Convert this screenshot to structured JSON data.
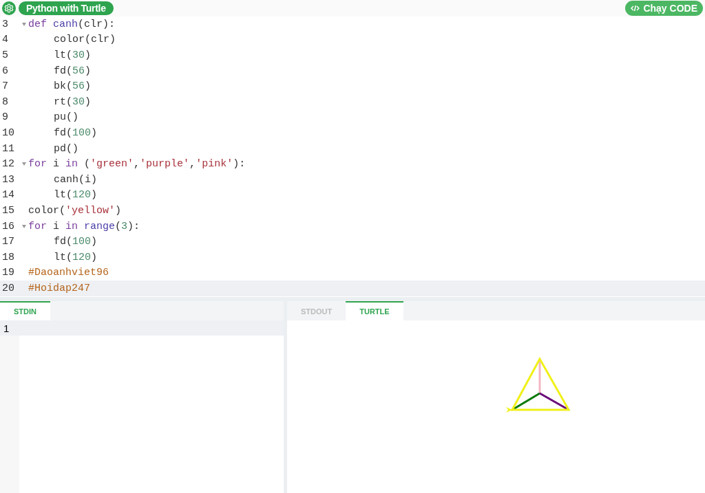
{
  "header": {
    "title": "Python with Turtle",
    "run_button": "Chạy CODE"
  },
  "editor": {
    "lines": [
      {
        "number": "3",
        "fold": true,
        "current": false,
        "indent": false,
        "tokens": [
          {
            "kind": "kw",
            "text": "def "
          },
          {
            "kind": "def",
            "text": "canh"
          },
          {
            "kind": "plain",
            "text": "(clr):"
          }
        ]
      },
      {
        "number": "4",
        "fold": false,
        "current": false,
        "indent": true,
        "tokens": [
          {
            "kind": "plain",
            "text": "color(clr)"
          }
        ]
      },
      {
        "number": "5",
        "fold": false,
        "current": false,
        "indent": true,
        "tokens": [
          {
            "kind": "plain",
            "text": "lt("
          },
          {
            "kind": "num",
            "text": "30"
          },
          {
            "kind": "plain",
            "text": ")"
          }
        ]
      },
      {
        "number": "6",
        "fold": false,
        "current": false,
        "indent": true,
        "tokens": [
          {
            "kind": "plain",
            "text": "fd("
          },
          {
            "kind": "num",
            "text": "56"
          },
          {
            "kind": "plain",
            "text": ")"
          }
        ]
      },
      {
        "number": "7",
        "fold": false,
        "current": false,
        "indent": true,
        "tokens": [
          {
            "kind": "plain",
            "text": "bk("
          },
          {
            "kind": "num",
            "text": "56"
          },
          {
            "kind": "plain",
            "text": ")"
          }
        ]
      },
      {
        "number": "8",
        "fold": false,
        "current": false,
        "indent": true,
        "tokens": [
          {
            "kind": "plain",
            "text": "rt("
          },
          {
            "kind": "num",
            "text": "30"
          },
          {
            "kind": "plain",
            "text": ")"
          }
        ]
      },
      {
        "number": "9",
        "fold": false,
        "current": false,
        "indent": true,
        "tokens": [
          {
            "kind": "plain",
            "text": "pu()"
          }
        ]
      },
      {
        "number": "10",
        "fold": false,
        "current": false,
        "indent": true,
        "tokens": [
          {
            "kind": "plain",
            "text": "fd("
          },
          {
            "kind": "num",
            "text": "100"
          },
          {
            "kind": "plain",
            "text": ")"
          }
        ]
      },
      {
        "number": "11",
        "fold": false,
        "current": false,
        "indent": true,
        "tokens": [
          {
            "kind": "plain",
            "text": "pd()"
          }
        ]
      },
      {
        "number": "12",
        "fold": true,
        "current": false,
        "indent": false,
        "tokens": [
          {
            "kind": "kw",
            "text": "for"
          },
          {
            "kind": "plain",
            "text": " i "
          },
          {
            "kind": "kw",
            "text": "in"
          },
          {
            "kind": "plain",
            "text": " ("
          },
          {
            "kind": "str",
            "text": "'green'"
          },
          {
            "kind": "plain",
            "text": ","
          },
          {
            "kind": "str",
            "text": "'purple'"
          },
          {
            "kind": "plain",
            "text": ","
          },
          {
            "kind": "str",
            "text": "'pink'"
          },
          {
            "kind": "plain",
            "text": "):"
          }
        ]
      },
      {
        "number": "13",
        "fold": false,
        "current": false,
        "indent": true,
        "tokens": [
          {
            "kind": "plain",
            "text": "canh(i)"
          }
        ]
      },
      {
        "number": "14",
        "fold": false,
        "current": false,
        "indent": true,
        "tokens": [
          {
            "kind": "plain",
            "text": "lt("
          },
          {
            "kind": "num",
            "text": "120"
          },
          {
            "kind": "plain",
            "text": ")"
          }
        ]
      },
      {
        "number": "15",
        "fold": false,
        "current": false,
        "indent": false,
        "tokens": [
          {
            "kind": "plain",
            "text": "color("
          },
          {
            "kind": "str",
            "text": "'yellow'"
          },
          {
            "kind": "plain",
            "text": ")"
          }
        ]
      },
      {
        "number": "16",
        "fold": true,
        "current": false,
        "indent": false,
        "tokens": [
          {
            "kind": "kw",
            "text": "for"
          },
          {
            "kind": "plain",
            "text": " i "
          },
          {
            "kind": "kw",
            "text": "in "
          },
          {
            "kind": "def",
            "text": "range"
          },
          {
            "kind": "plain",
            "text": "("
          },
          {
            "kind": "num",
            "text": "3"
          },
          {
            "kind": "plain",
            "text": "):"
          }
        ]
      },
      {
        "number": "17",
        "fold": false,
        "current": false,
        "indent": true,
        "tokens": [
          {
            "kind": "plain",
            "text": "fd("
          },
          {
            "kind": "num",
            "text": "100"
          },
          {
            "kind": "plain",
            "text": ")"
          }
        ]
      },
      {
        "number": "18",
        "fold": false,
        "current": false,
        "indent": true,
        "tokens": [
          {
            "kind": "plain",
            "text": "lt("
          },
          {
            "kind": "num",
            "text": "120"
          },
          {
            "kind": "plain",
            "text": ")"
          }
        ]
      },
      {
        "number": "19",
        "fold": false,
        "current": false,
        "indent": false,
        "tokens": [
          {
            "kind": "comment",
            "text": "#Daoanhviet96"
          }
        ]
      },
      {
        "number": "20",
        "fold": false,
        "current": true,
        "indent": false,
        "tokens": [
          {
            "kind": "comment",
            "text": "#Hoidap247"
          }
        ]
      }
    ]
  },
  "input_panel": {
    "tabs": [
      {
        "label": "STDIN",
        "selected": true
      }
    ],
    "lines": [
      {
        "number": "1",
        "current": true
      }
    ]
  },
  "output_panel": {
    "tabs": [
      {
        "label": "STDOUT",
        "selected": false
      },
      {
        "label": "TURTLE",
        "selected": true
      }
    ]
  }
}
